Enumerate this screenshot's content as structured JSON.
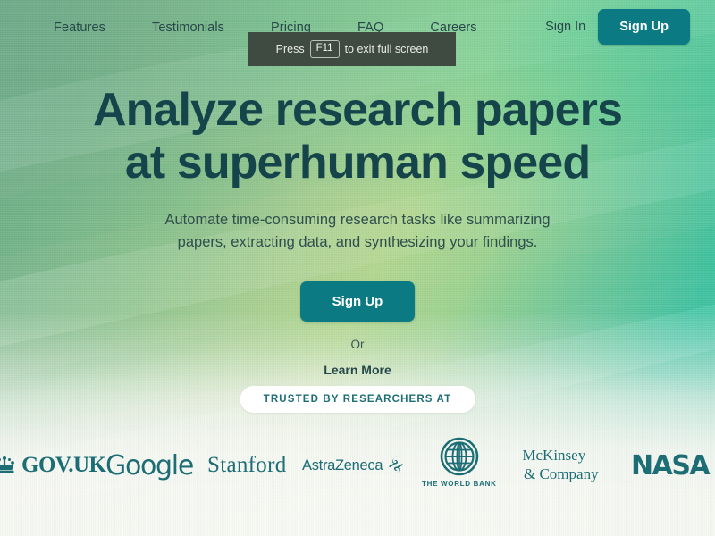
{
  "nav": {
    "links": [
      {
        "label": "Features",
        "name": "nav-link-features"
      },
      {
        "label": "Testimonials",
        "name": "nav-link-testimonials"
      },
      {
        "label": "Pricing",
        "name": "nav-link-pricing"
      },
      {
        "label": "FAQ",
        "name": "nav-link-faq"
      },
      {
        "label": "Careers",
        "name": "nav-link-careers"
      }
    ],
    "sign_in_label": "Sign In",
    "sign_up_label": "Sign Up"
  },
  "fullscreen_toast": {
    "prefix": "Press",
    "key": "F11",
    "suffix": "to exit full screen"
  },
  "hero": {
    "title_line1": "Analyze research papers",
    "title_line2": "at superhuman speed",
    "subtitle_line1": "Automate time-consuming research tasks like summarizing",
    "subtitle_line2": "papers, extracting data, and synthesizing your findings.",
    "cta_primary_label": "Sign Up",
    "or_label": "Or",
    "cta_secondary_label": "Learn More"
  },
  "social_proof": {
    "pill_label": "TRUSTED BY RESEARCHERS AT",
    "logos": [
      {
        "name": "logo-govuk",
        "text": "GOV.UK",
        "icon": "crown-icon"
      },
      {
        "name": "logo-google",
        "text": "Google",
        "icon": ""
      },
      {
        "name": "logo-stanford",
        "text": "Stanford",
        "icon": ""
      },
      {
        "name": "logo-astrazeneca",
        "text": "AstraZeneca",
        "icon": "astrazeneca-swirl-icon"
      },
      {
        "name": "logo-world-bank",
        "text": "THE WORLD BANK",
        "icon": "globe-icon"
      },
      {
        "name": "logo-mckinsey",
        "text": "McKinsey",
        "text2": "& Company",
        "icon": ""
      },
      {
        "name": "logo-nasa",
        "text": "NASA",
        "icon": ""
      }
    ]
  },
  "colors": {
    "brand_teal": "#0c7a82",
    "heading_dark": "#15444b",
    "logo_teal": "#1d6d75",
    "toast_bg": "#3f4a41",
    "page_bottom": "#f3f5f0"
  }
}
